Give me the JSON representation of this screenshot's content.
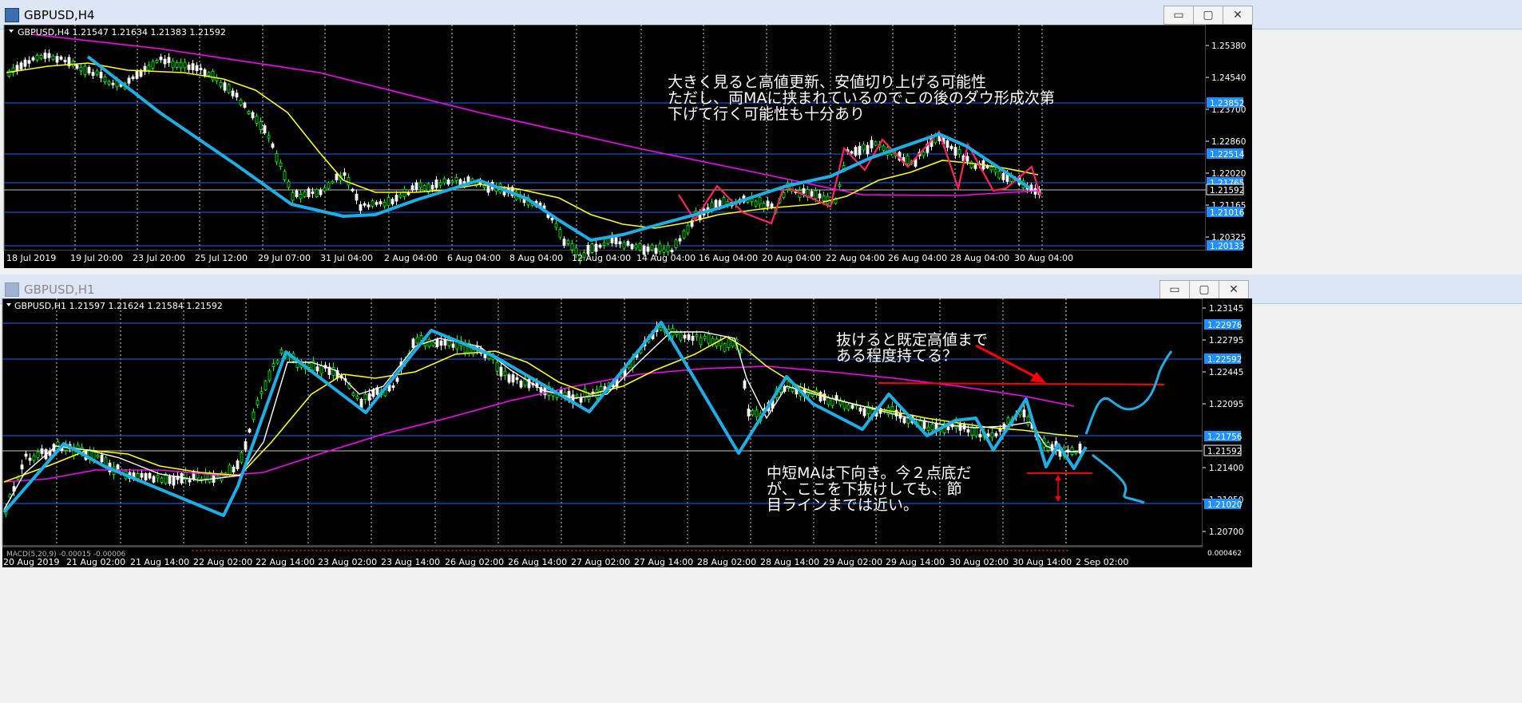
{
  "window_top": {
    "title": "GBPUSD,H4",
    "info": "GBPUSD,H4  1.21547 1.21634 1.21383 1.21592",
    "price_ticks": [
      "1.25380",
      "1.24540",
      "1.23700",
      "1.22860",
      "1.22020",
      "1.21165",
      "1.20325"
    ],
    "price_labels": [
      {
        "text": "1.23852",
        "color": "#1e90ff"
      },
      {
        "text": "1.22514",
        "color": "#1e90ff"
      },
      {
        "text": "1.21765",
        "color": "#1e90ff"
      },
      {
        "text": "1.21592",
        "color": "#000000"
      },
      {
        "text": "1.21016",
        "color": "#1e90ff"
      },
      {
        "text": "1.20133",
        "color": "#1e90ff"
      }
    ],
    "dates": [
      "18 Jul 2019",
      "19 Jul 20:00",
      "23 Jul 20:00",
      "25 Jul 12:00",
      "29 Jul 07:00",
      "31 Jul 04:00",
      "2 Aug 04:00",
      "6 Aug 04:00",
      "8 Aug 04:00",
      "12 Aug 04:00",
      "14 Aug 04:00",
      "16 Aug 04:00",
      "20 Aug 04:00",
      "22 Aug 04:00",
      "26 Aug 04:00",
      "28 Aug 04:00",
      "30 Aug 04:00"
    ],
    "note": [
      "大きく見ると高値更新、安値切り上げる可能性",
      "ただし、両MAに挟まれているのでこの後のダウ形成次第",
      "下げて行く可能性も十分あり"
    ]
  },
  "window_bottom": {
    "title": "GBPUSD,H1",
    "info": "GBPUSD,H1  1.21597 1.21624 1.21584 1.21592",
    "price_ticks": [
      "1.23145",
      "1.22795",
      "1.22445",
      "1.22095",
      "1.21400",
      "1.21050",
      "1.20700"
    ],
    "price_labels": [
      {
        "text": "1.22976",
        "color": "#1e90ff"
      },
      {
        "text": "1.22592",
        "color": "#1e90ff"
      },
      {
        "text": "1.21756",
        "color": "#1e90ff"
      },
      {
        "text": "1.21592",
        "color": "#000000"
      },
      {
        "text": "1.21020",
        "color": "#1e90ff"
      }
    ],
    "indicator_label": "MACD(5,20,9) -0.00015 -0.00006",
    "indicator_value": "0.000462",
    "dates": [
      "20 Aug 2019",
      "21 Aug 02:00",
      "21 Aug 14:00",
      "22 Aug 02:00",
      "22 Aug 14:00",
      "23 Aug 02:00",
      "23 Aug 14:00",
      "26 Aug 02:00",
      "26 Aug 14:00",
      "27 Aug 02:00",
      "27 Aug 14:00",
      "28 Aug 02:00",
      "28 Aug 14:00",
      "29 Aug 02:00",
      "29 Aug 14:00",
      "30 Aug 02:00",
      "30 Aug 14:00",
      "2 Sep 02:00"
    ],
    "note_top": [
      "抜けると既定高値まで",
      "ある程度持てる？"
    ],
    "note_bottom": [
      "中短MAは下向き。今２点底だ",
      "が、ここを下抜けしても、節",
      "目ラインまでは近い。"
    ]
  },
  "controls": {
    "minimize": "▭",
    "maximize": "▢",
    "close": "✕"
  },
  "colors": {
    "bg": "#000000",
    "bull": "#00ff00",
    "bear": "#ffffff",
    "ma_yellow": "#ffff00",
    "ma_magenta": "#ff00ff",
    "ma_white": "#ffffff",
    "zigzag": "#1eaee6",
    "zigzag_red": "#ff2060",
    "hline": "#1e64ff",
    "annotation": "#ff0000",
    "text": "#ffffff"
  }
}
